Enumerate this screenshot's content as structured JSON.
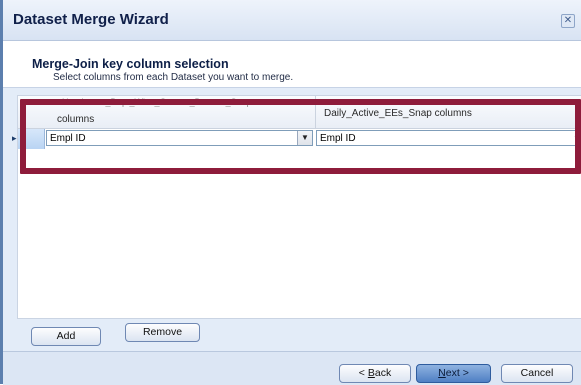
{
  "window": {
    "title": "Dataset Merge Wizard",
    "close_glyph": "✕"
  },
  "header": {
    "section_title": "Merge-Join key column selection",
    "section_subtitle": "Select columns from each Dataset you want to merge."
  },
  "grid": {
    "column1_header_partial": "Headcount_Dept_Wise_Current_Dataset_Snap",
    "column1_header": "columns",
    "column2_header": "Daily_Active_EEs_Snap columns",
    "rows": [
      {
        "left_value": "Empl ID",
        "right_value": "Empl ID"
      }
    ]
  },
  "buttons": {
    "add": "Add",
    "remove": "Remove",
    "back_prefix": "< ",
    "back_accel": "B",
    "back_rest": "ack",
    "next_accel": "N",
    "next_rest": "ext >",
    "cancel": "Cancel"
  },
  "colors": {
    "highlight": "#8e1c3b",
    "title_text": "#10204a",
    "primary_button": "#4f7fc4"
  },
  "icons": {
    "close": "close-icon",
    "dropdown": "chevron-down-icon",
    "row_selector": "row-pointer-icon"
  }
}
